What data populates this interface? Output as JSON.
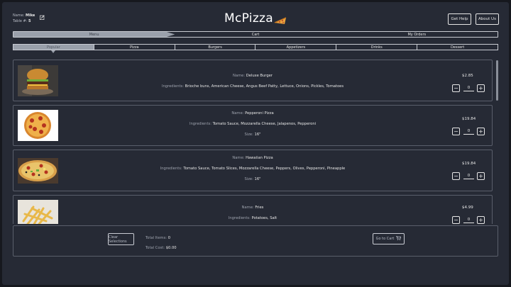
{
  "user": {
    "name_label": "Name:",
    "name_value": "Mike",
    "table_label": "Table #:",
    "table_value": "5"
  },
  "app": {
    "title": "McPizza"
  },
  "header": {
    "help_label": "Get Help",
    "about_label": "About Us"
  },
  "nav": {
    "tabs": [
      {
        "label": "Menu",
        "active": true
      },
      {
        "label": "Cart"
      },
      {
        "label": "My Orders"
      }
    ]
  },
  "categories": [
    {
      "label": "Popular",
      "active": true
    },
    {
      "label": "Pizza"
    },
    {
      "label": "Burgers"
    },
    {
      "label": "Appetizers"
    },
    {
      "label": "Drinks"
    },
    {
      "label": "Dessert"
    }
  ],
  "labels": {
    "name": "Name:",
    "ingredients": "Ingredients:",
    "size": "Size:"
  },
  "items": [
    {
      "name": "Deluxe Burger",
      "ingredients": "Brioche buns, American Cheese, Angus Beef Patty, Lettuce, Onions, Pickles, Tomatoes",
      "price": "$2.85",
      "qty": "0"
    },
    {
      "name": "Pepperoni Pizza",
      "ingredients": "Tomato Sauce, Mozzarella Cheese, Jalapenos, Pepperoni",
      "size": "16\"",
      "price": "$19.84",
      "qty": "0"
    },
    {
      "name": "Hawaiian Pizza",
      "ingredients": "Tomato Sauce, Tomato Slices, Mozzarella Cheese, Peppers, Olives, Pepperoni, Pineapple",
      "size": "16\"",
      "price": "$19.84",
      "qty": "0"
    },
    {
      "name": "Fries",
      "ingredients": "Potatoes, Salt",
      "price": "$4.99",
      "qty": "0"
    }
  ],
  "footer": {
    "clear_label": "Clear Selections",
    "items_label": "Total Items:",
    "items_value": "0",
    "cost_label": "Total Cost:",
    "cost_value": "$0.00",
    "goto_label": "Go to Cart"
  },
  "colors": {
    "background": "#262a35",
    "active_tab": "#9aa0ab",
    "border": "#c9ccd3"
  }
}
